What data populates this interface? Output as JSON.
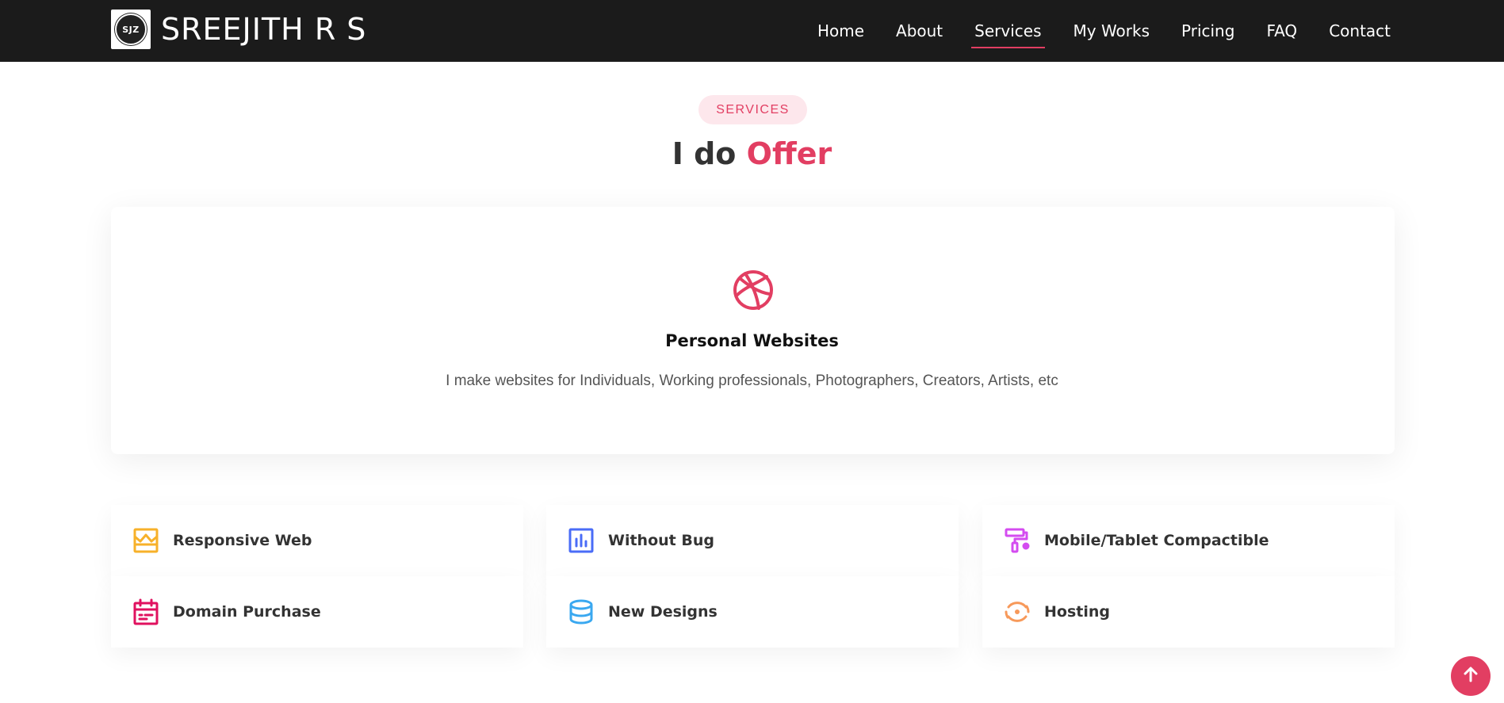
{
  "brand": {
    "logo_text": "SJZ",
    "name": "SREEJITH R S"
  },
  "nav": {
    "items": [
      "Home",
      "About",
      "Services",
      "My Works",
      "Pricing",
      "FAQ",
      "Contact"
    ],
    "active": "Services"
  },
  "section": {
    "badge": "SERVICES",
    "heading_plain": "I do",
    "heading_accent": "Offer"
  },
  "main_service": {
    "icon": "dribbble-icon",
    "title": "Personal Websites",
    "description": "I make websites for Individuals, Working professionals, Photographers, Creators, Artists, etc"
  },
  "features": [
    {
      "label": "Responsive Web",
      "icon": "storefront-icon",
      "color": "#f7b12a"
    },
    {
      "label": "Domain Purchase",
      "icon": "calendar-icon",
      "color": "#e0115f"
    },
    {
      "label": "Without Bug",
      "icon": "bar-chart-icon",
      "color": "#4a6cf7"
    },
    {
      "label": "New Designs",
      "icon": "database-icon",
      "color": "#3aa8f0"
    },
    {
      "label": "Mobile/Tablet Compactible",
      "icon": "paint-roller-icon",
      "color": "#d44cf0"
    },
    {
      "label": "Hosting",
      "icon": "target-icon",
      "color": "#f7995a"
    }
  ],
  "colors": {
    "accent": "#e23e62",
    "navbar": "#1b1b1b"
  },
  "scroll_top_icon": "arrow-up-icon"
}
